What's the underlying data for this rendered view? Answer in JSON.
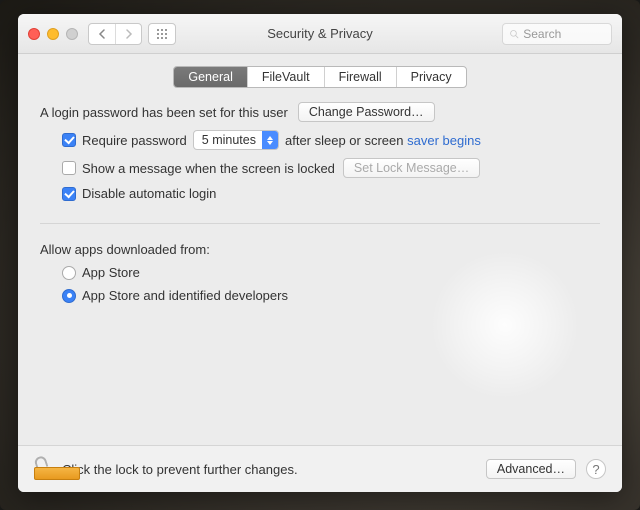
{
  "header": {
    "title": "Security & Privacy",
    "search_placeholder": "Search"
  },
  "tabs": [
    {
      "label": "General",
      "active": true
    },
    {
      "label": "FileVault",
      "active": false
    },
    {
      "label": "Firewall",
      "active": false
    },
    {
      "label": "Privacy",
      "active": false
    }
  ],
  "login": {
    "password_set_text": "A login password has been set for this user",
    "change_password_label": "Change Password…",
    "require_password_label": "Require password",
    "require_password_checked": true,
    "delay_value": "5 minutes",
    "after_sleep_text_plain": "after sleep or screen",
    "after_sleep_text_link": "saver begins",
    "show_message_label": "Show a message when the screen is locked",
    "show_message_checked": false,
    "set_lock_message_label": "Set Lock Message…",
    "disable_auto_login_label": "Disable automatic login",
    "disable_auto_login_checked": true
  },
  "gatekeeper": {
    "header": "Allow apps downloaded from:",
    "options": [
      {
        "label": "App Store",
        "selected": false
      },
      {
        "label": "App Store and identified developers",
        "selected": true
      }
    ]
  },
  "footer": {
    "lock_text": "Click the lock to prevent further changes.",
    "advanced_label": "Advanced…",
    "help_label": "?"
  }
}
